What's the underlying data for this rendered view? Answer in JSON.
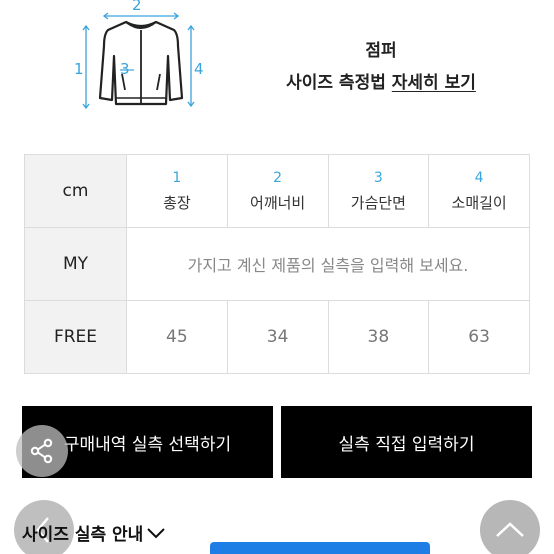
{
  "diagram": {
    "dim_labels": [
      "1",
      "2",
      "3",
      "4"
    ],
    "icon": "jumper-jacket-icon"
  },
  "product_type": "점퍼",
  "measure_guide": {
    "text": "사이즈 측정법",
    "link": "자세히 보기"
  },
  "size_table": {
    "header_label": "cm",
    "columns": [
      {
        "num": "1",
        "name": "총장"
      },
      {
        "num": "2",
        "name": "어깨너비"
      },
      {
        "num": "3",
        "name": "가슴단면"
      },
      {
        "num": "4",
        "name": "소매길이"
      }
    ],
    "my_row": {
      "label": "MY",
      "prompt": "가지고 계신 제품의 실측을 입력해 보세요."
    },
    "rows": [
      {
        "label": "FREE",
        "values": [
          "45",
          "34",
          "38",
          "63"
        ]
      }
    ]
  },
  "buttons": {
    "select_from_purchases": "구매내역 실측 선택하기",
    "enter_directly": "실측 직접 입력하기"
  },
  "size_guide": {
    "label": "사이즈 실측 안내",
    "icon": "chevron-down-icon"
  },
  "floating": {
    "share_icon": "share-icon",
    "prev_icon": "chevron-left-icon",
    "top_icon": "chevron-up-icon"
  },
  "colors": {
    "accent_blue": "#3aa5dc",
    "button_black": "#000000",
    "cta_blue": "#1f7ee6",
    "rowhead_bg": "#f2f2f2"
  }
}
